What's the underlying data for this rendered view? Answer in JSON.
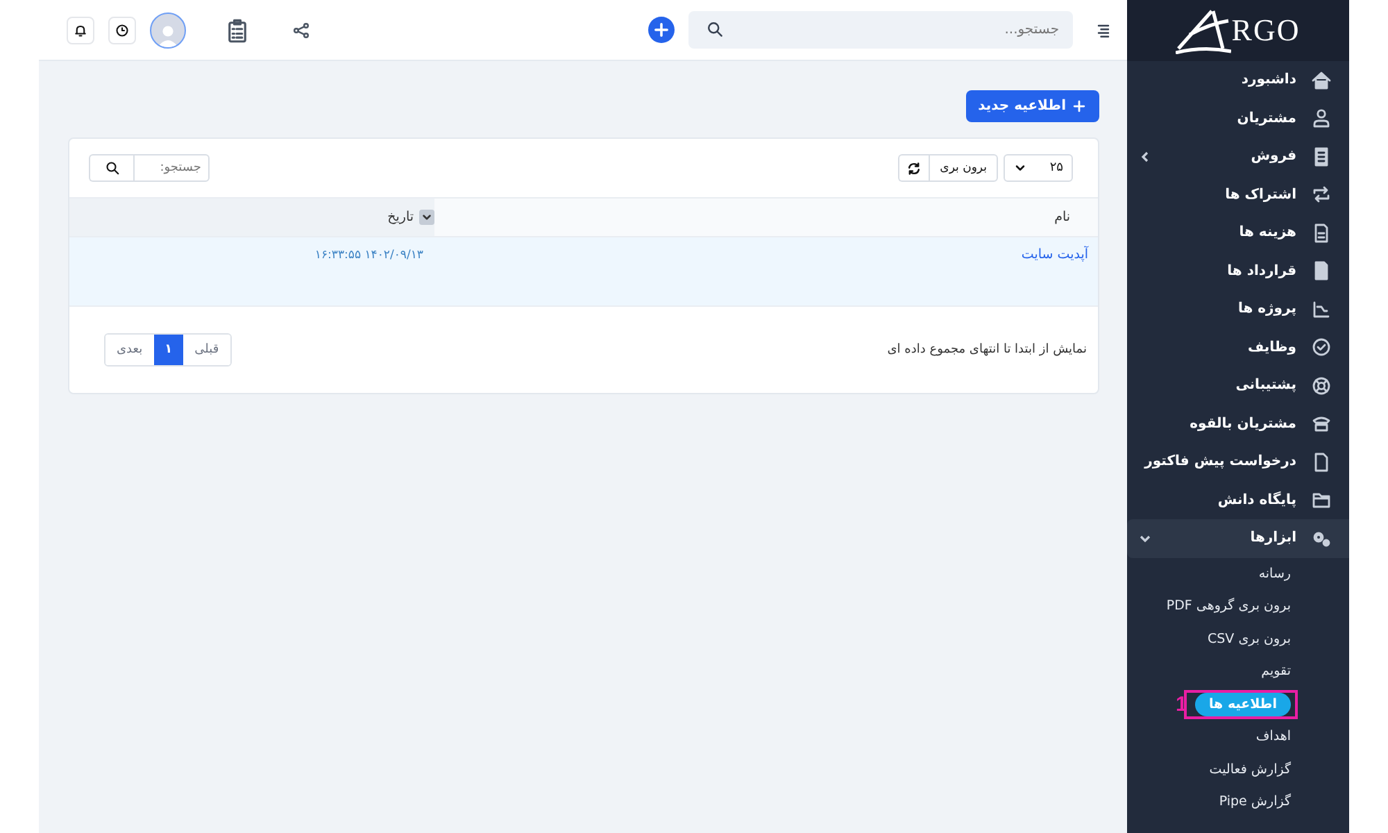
{
  "sidebar": {
    "logo_text": "RGO",
    "items": [
      {
        "label": "داشبورد",
        "selected": false
      },
      {
        "label": "مشتریان",
        "selected": false
      },
      {
        "label": "فروش",
        "selected": false,
        "expandable": true,
        "expanded": false
      },
      {
        "label": "اشتراک ها",
        "selected": false
      },
      {
        "label": "هزینه ها",
        "selected": false
      },
      {
        "label": "قرارداد ها",
        "selected": false
      },
      {
        "label": "پروژه ها",
        "selected": false
      },
      {
        "label": "وظایف",
        "selected": false
      },
      {
        "label": "پشتیبانی",
        "selected": false
      },
      {
        "label": "مشتریان بالقوه",
        "selected": false
      },
      {
        "label": "درخواست پیش فاکتور",
        "selected": false
      },
      {
        "label": "پایگاه دانش",
        "selected": false
      },
      {
        "label": "ابزارها",
        "selected": true,
        "expandable": true,
        "expanded": true,
        "children": [
          {
            "label": "رسانه",
            "selected": false
          },
          {
            "label": "برون بری گروهی PDF",
            "selected": false
          },
          {
            "label": "برون بری CSV",
            "selected": false
          },
          {
            "label": "تقویم",
            "selected": false
          },
          {
            "label": "اطلاعیه ها",
            "selected": true,
            "annotation": "1"
          },
          {
            "label": "اهداف",
            "selected": false
          },
          {
            "label": "گزارش فعالیت",
            "selected": false
          },
          {
            "label": "گزارش Pipe",
            "selected": false
          }
        ]
      }
    ]
  },
  "topbar": {
    "search": {
      "placeholder": "جستجو..."
    }
  },
  "new_button": "اطلاعیه جدید",
  "table_panel": {
    "page_size": "۲۵",
    "export_button": "برون بری",
    "search": {
      "placeholder": "جستجو:"
    },
    "columns": [
      {
        "label": "نام",
        "sortable": false
      },
      {
        "label": "تاریخ",
        "sortable": true
      }
    ],
    "rows": [
      {
        "name": "آپدیت سایت",
        "date": "۱۴۰۲/۰۹/۱۳ ۱۶:۳۳:۵۵"
      }
    ],
    "info": "نمایش از ابتدا تا انتهای مجموع داده ای",
    "pagination": [
      {
        "label": "قبلی",
        "selected": false
      },
      {
        "label": "۱",
        "selected": true
      },
      {
        "label": "بعدی",
        "selected": false
      }
    ]
  }
}
